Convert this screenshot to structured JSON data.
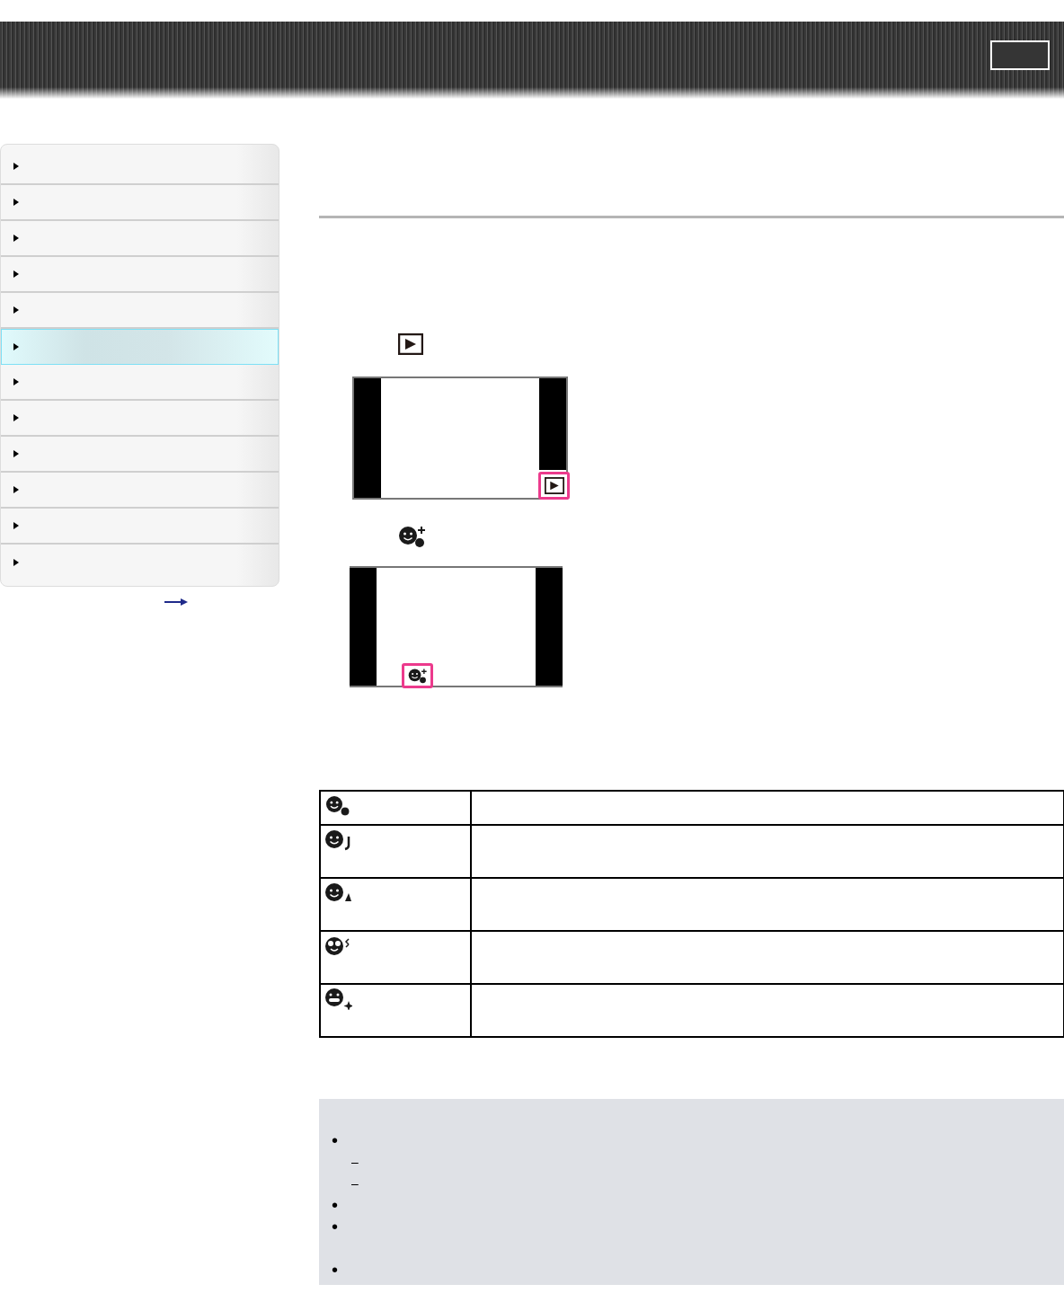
{
  "sidebar": {
    "items": [
      {
        "selected": false
      },
      {
        "selected": false
      },
      {
        "selected": false
      },
      {
        "selected": false
      },
      {
        "selected": false
      },
      {
        "selected": true
      },
      {
        "selected": false
      },
      {
        "selected": false
      },
      {
        "selected": false
      },
      {
        "selected": false
      },
      {
        "selected": false
      },
      {
        "selected": false
      }
    ]
  },
  "figures": [
    {
      "kind": "play"
    },
    {
      "kind": "face"
    }
  ],
  "table": {
    "rows": [
      {
        "kind": "drop"
      },
      {
        "kind": "note"
      },
      {
        "kind": "bell"
      },
      {
        "kind": "eyes"
      },
      {
        "kind": "sparkle"
      }
    ]
  },
  "notes": {
    "items": [
      {
        "kind": "bullet",
        "mark": "•"
      },
      {
        "kind": "dash",
        "mark": "–"
      },
      {
        "kind": "dash",
        "mark": "–"
      },
      {
        "kind": "bullet",
        "mark": "•"
      },
      {
        "kind": "bullet",
        "mark": "•",
        "tall": true
      },
      {
        "kind": "bullet",
        "mark": "•"
      }
    ]
  }
}
